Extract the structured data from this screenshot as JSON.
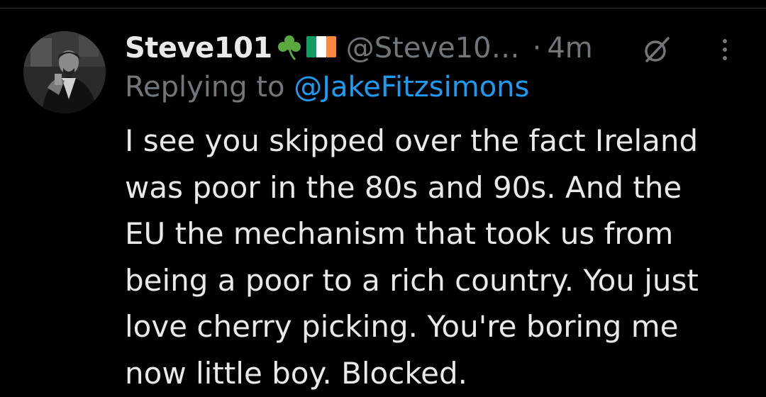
{
  "tweet": {
    "display_name": "Steve101",
    "display_name_emojis": [
      "shamrock-emoji",
      "irish-flag-emoji"
    ],
    "handle": "@Steve10…",
    "separator": "·",
    "time_ago": "4m",
    "reply_prefix": "Replying to",
    "reply_mention": "@JakeFitzsimons",
    "body_lines": [
      "I see you skipped over the fact Ireland",
      "was poor in the 80s and 90s. And the",
      "EU the mechanism that took us from",
      "being a poor to a rich country. You just",
      "love cherry picking. You're boring me",
      "now little boy. Blocked."
    ]
  },
  "icons": {
    "grok": "grok-icon",
    "more": "more-options-icon"
  },
  "colors": {
    "background": "#000000",
    "primary_text": "#e7e9ea",
    "secondary_text": "#71767b",
    "link": "#1d9bf0"
  }
}
